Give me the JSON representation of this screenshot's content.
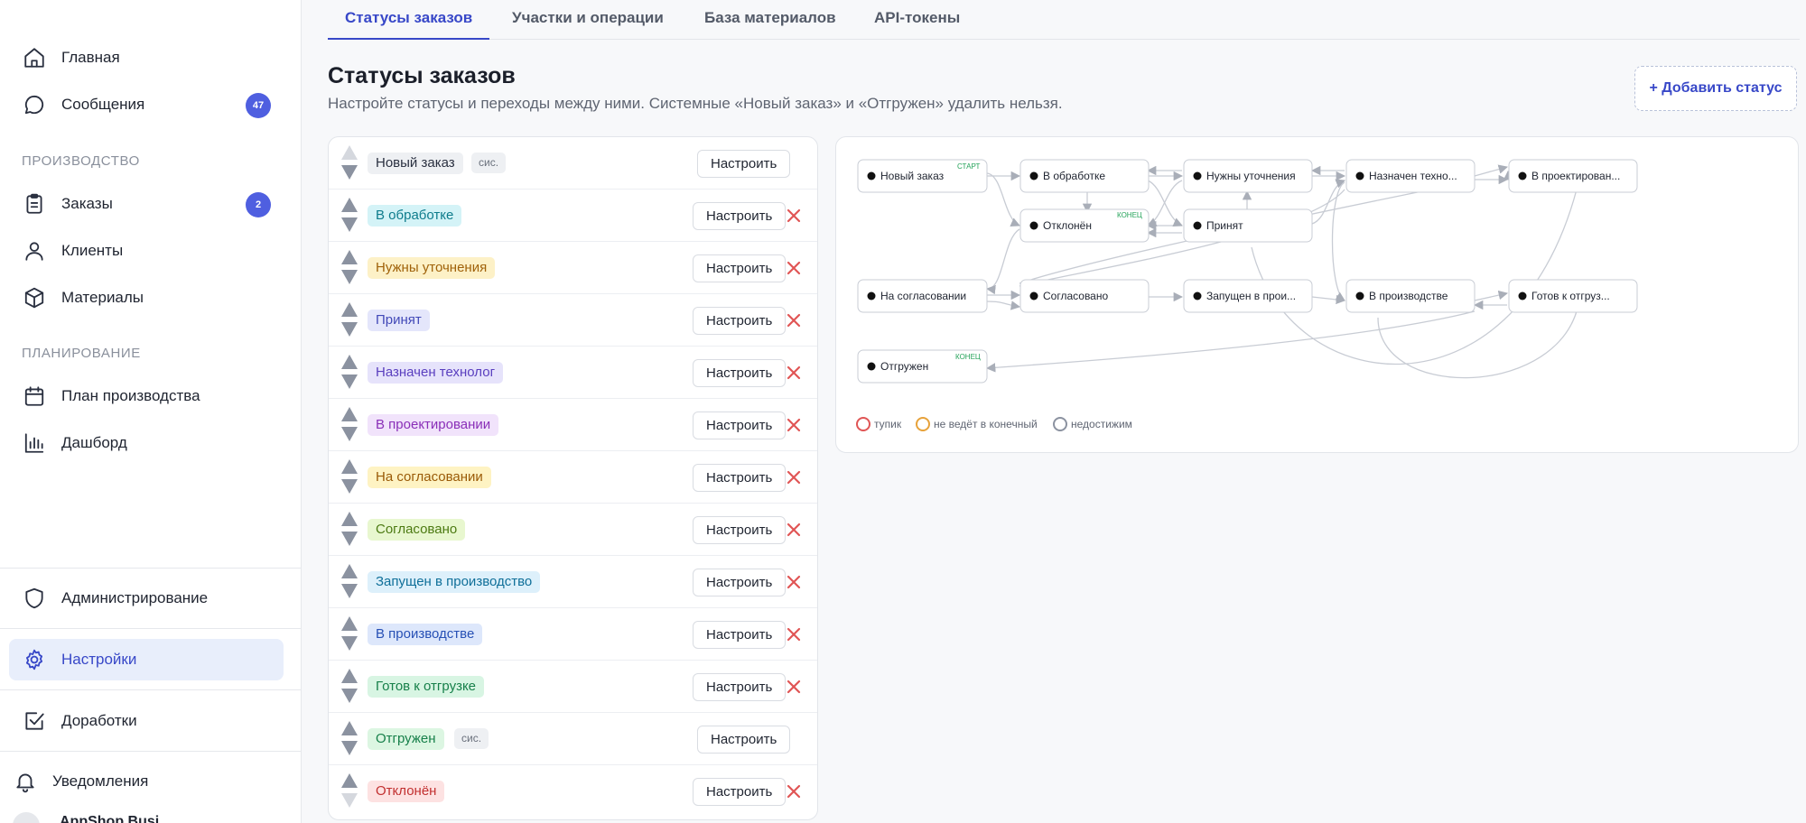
{
  "sidebar": {
    "items": [
      {
        "label": "Главная",
        "icon": "home-icon"
      },
      {
        "label": "Сообщения",
        "icon": "message-icon",
        "badge": "47"
      },
      {
        "label": "Заказы",
        "icon": "clipboard-icon",
        "badge": "2"
      },
      {
        "label": "Клиенты",
        "icon": "user-icon"
      },
      {
        "label": "Материалы",
        "icon": "box-icon"
      },
      {
        "label": "План производства",
        "icon": "calendar-icon"
      },
      {
        "label": "Дашборд",
        "icon": "bar-chart-icon"
      },
      {
        "label": "Администрирование",
        "icon": "shield-icon"
      },
      {
        "label": "Настройки",
        "icon": "gear-icon"
      },
      {
        "label": "Доработки",
        "icon": "checkbox-icon"
      },
      {
        "label": "Уведомления",
        "icon": "bell-icon"
      }
    ],
    "sections": {
      "production": "ПРОИЗВОДСТВО",
      "planning": "ПЛАНИРОВАНИЕ"
    },
    "footer_text": "AppShop Busi"
  },
  "tabs": [
    {
      "label": "Статусы заказов"
    },
    {
      "label": "Участки и операции"
    },
    {
      "label": "База материалов"
    },
    {
      "label": "API-токены"
    }
  ],
  "page": {
    "title": "Статусы заказов",
    "subtitle": "Настройте статусы и переходы между ними. Системные «Новый заказ» и «Отгружен» удалить нельзя.",
    "add_button": "+ Добавить статус"
  },
  "statuses": {
    "configure_label": "Настроить",
    "system_label": "сис.",
    "items": [
      {
        "name": "Новый заказ",
        "bg": "#eef0f3",
        "fg": "#2a3040"
      },
      {
        "name": "В обработке",
        "bg": "#d4f3f7",
        "fg": "#0e7c8c"
      },
      {
        "name": "Нужны уточнения",
        "bg": "#fdf1c7",
        "fg": "#a0620a"
      },
      {
        "name": "Принят",
        "bg": "#e4e6fb",
        "fg": "#4249b8"
      },
      {
        "name": "Назначен технолог",
        "bg": "#e6e3fb",
        "fg": "#5a3fbf"
      },
      {
        "name": "В проектировании",
        "bg": "#f1e3fb",
        "fg": "#8a2fb8"
      },
      {
        "name": "На согласовании",
        "bg": "#fef3c3",
        "fg": "#9a5a07"
      },
      {
        "name": "Согласовано",
        "bg": "#e8f7cf",
        "fg": "#4c7a12"
      },
      {
        "name": "Запущен в производство",
        "bg": "#ddf0fb",
        "fg": "#0f6f99"
      },
      {
        "name": "В производстве",
        "bg": "#dde7fb",
        "fg": "#2750b5"
      },
      {
        "name": "Готов к отгрузке",
        "bg": "#d8f5e3",
        "fg": "#17804a"
      },
      {
        "name": "Отгружен",
        "bg": "#dcf6e2",
        "fg": "#17804a"
      },
      {
        "name": "Отклонён",
        "bg": "#fde2e2",
        "fg": "#c23030"
      }
    ]
  },
  "graph": {
    "nodes": [
      {
        "label": "Новый заказ",
        "tag": "СТАРТ"
      },
      {
        "label": "В обработке"
      },
      {
        "label": "Нужны уточнения"
      },
      {
        "label": "Назначен техно..."
      },
      {
        "label": "В проектирован..."
      },
      {
        "label": "Отклонён",
        "tag": "КОНЕЦ"
      },
      {
        "label": "Принят"
      },
      {
        "label": "На согласовании"
      },
      {
        "label": "Согласовано"
      },
      {
        "label": "Запущен в прои..."
      },
      {
        "label": "В производстве"
      },
      {
        "label": "Готов к отгруз..."
      },
      {
        "label": "Отгружен",
        "tag": "КОНЕЦ"
      }
    ],
    "legend": [
      {
        "label": "тупик",
        "color": "#e05555"
      },
      {
        "label": "не ведёт в конечный",
        "color": "#e7a23a"
      },
      {
        "label": "недостижим",
        "color": "#8b92a0"
      }
    ]
  }
}
